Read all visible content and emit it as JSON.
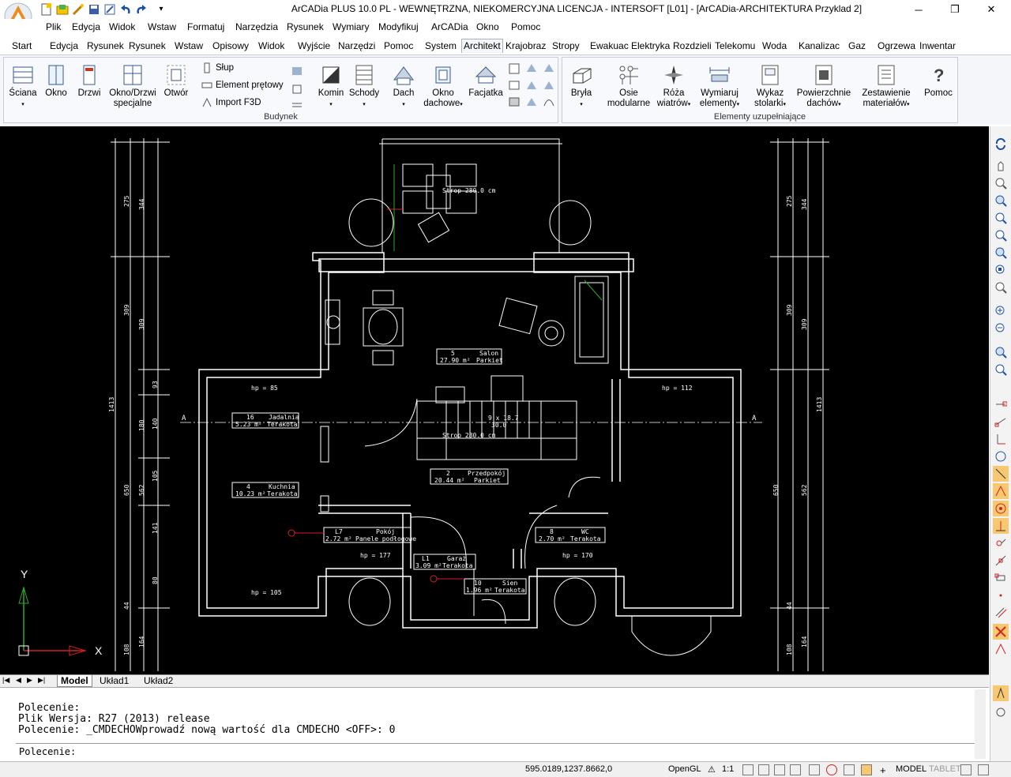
{
  "window": {
    "title": "ArCADia PLUS 10.0 PL - WEWNĘTRZNA, NIEKOMERCYJNA LICENCJA - INTERSOFT [L01] - [ArCADia-ARCHITEKTURA Przyklad 2]",
    "min": "─",
    "restore": "❐",
    "close": "✕"
  },
  "qat": {
    "more": "▾"
  },
  "menu": [
    "Plik",
    "Edycja",
    "Widok",
    "Wstaw",
    "Formatuj",
    "Narzędzia",
    "Rysunek",
    "Wymiary",
    "Modyfikuj",
    "ArCADia",
    "Okno",
    "Pomoc"
  ],
  "tabs": [
    "Start",
    "Edycja",
    "Rysunek",
    "Rysunek",
    "Wstaw",
    "Opisowy",
    "Widok",
    "Wyjście",
    "Narzędzi",
    "Pomoc",
    "System",
    "Architekt",
    "Krajobraz",
    "Stropy",
    "Ewakuac",
    "Elektryka",
    "Rozdzieli",
    "Telekomu",
    "Woda",
    "Kanalizac",
    "Gaz",
    "Ogrzewa",
    "Inwentar"
  ],
  "ribbon": {
    "budynek": {
      "label": "Budynek",
      "sciana": "Ściana",
      "okno": "Okno",
      "drzwi": "Drzwi",
      "okno_drzwi_1": "Okno/Drzwi",
      "okno_drzwi_2": "specjalne",
      "otwor": "Otwór",
      "slup": "Słup",
      "element_pretowy": "Element prętowy",
      "import_f3d": "Import F3D",
      "komin": "Komin",
      "schody": "Schody",
      "dach": "Dach",
      "okno_dachowe_1": "Okno",
      "okno_dachowe_2": "dachowe",
      "facjatka": "Facjatka"
    },
    "elementy": {
      "label": "Elementy uzupełniające",
      "bryla": "Bryła",
      "osie_1": "Osie",
      "osie_2": "modularne",
      "roza_1": "Róża",
      "roza_2": "wiatrów",
      "wymiaruj_1": "Wymiaruj",
      "wymiaruj_2": "elementy",
      "wykaz_1": "Wykaz",
      "wykaz_2": "stolarki",
      "powierzchnie_1": "Powierzchnie",
      "powierzchnie_2": "dachów",
      "zestawienie_1": "Zestawienie",
      "zestawienie_2": "materiałów",
      "pomoc": "Pomoc"
    }
  },
  "drawing": {
    "rooms": [
      {
        "num": "5",
        "name": "Salon",
        "area": "27.90 m²",
        "floor": "Parkiet"
      },
      {
        "num": "16",
        "name": "Jadalnia",
        "area": "5.23 m²",
        "floor": "Terakota"
      },
      {
        "num": "4",
        "name": "Kuchnia",
        "area": "10.23 m²",
        "floor": "Terakota"
      },
      {
        "num": "2",
        "name": "Przedpokój",
        "area": "20.44 m²",
        "floor": "Parkiet"
      },
      {
        "num": "L7",
        "name": "Pokój",
        "area": "2.72 m²",
        "floor": "Panele podłogowe"
      },
      {
        "num": "8",
        "name": "WC",
        "area": "2.70 m²",
        "floor": "Terakota"
      },
      {
        "num": "L1",
        "name": "Garaż",
        "area": "3.09 m²",
        "floor": "Terakota"
      },
      {
        "num": "10",
        "name": "Sien",
        "area": "1.96 m²",
        "floor": "Terakota"
      }
    ],
    "heights": {
      "h1": "hp = 85",
      "h2": "hp = 112",
      "h3": "hp = 105",
      "h4": "hp = 177",
      "h5": "hp = 170"
    },
    "stairs": {
      "label": "9 x 18.7",
      "sub": "30.0"
    },
    "stropy": {
      "s1": "Strop 280.0 cm",
      "s2": "Strop 280.0 cm"
    },
    "dims_left": [
      "275",
      "344",
      "309",
      "309",
      "93",
      "140",
      "180",
      "650",
      "562",
      "105",
      "141",
      "80",
      "44",
      "108",
      "164",
      "1413"
    ],
    "dims_right": [
      "275",
      "344",
      "309",
      "309",
      "650",
      "562",
      "44",
      "108",
      "164",
      "1413"
    ],
    "ucs": {
      "y": "Y",
      "x": "X"
    },
    "section_mark": "A"
  },
  "layout_tabs": {
    "model": "Model",
    "uklad1": "Układ1",
    "uklad2": "Układ2"
  },
  "command": {
    "lines": [
      "Polecenie:",
      "Plik Wersja: R27 (2013) release",
      "Polecenie: _CMDECHOWprowadź nową wartość dla CMDECHO <OFF>: 0"
    ],
    "prompt": "Polecenie:"
  },
  "status": {
    "coords": "595.0189,1237.8662,0",
    "opengl": "OpenGL",
    "scale": "1:1",
    "model": "MODEL",
    "tablet": "TABLET"
  },
  "colors": {
    "accent": "#f08a1a",
    "ribbon_bg": "#f4f6f9",
    "canvas": "#000000"
  }
}
